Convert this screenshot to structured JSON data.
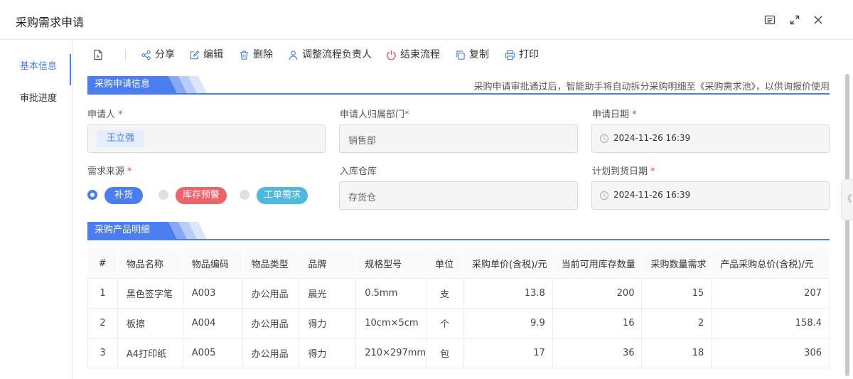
{
  "header": {
    "title": "采购需求申请",
    "icons": [
      "side-panel-icon",
      "expand-icon",
      "close-icon"
    ]
  },
  "sidenav": {
    "items": [
      {
        "label": "基本信息",
        "active": true
      },
      {
        "label": "审批进度",
        "active": false
      }
    ]
  },
  "toolbar": {
    "share": "分享",
    "edit": "编辑",
    "delete": "删除",
    "reassign": "调整流程负责人",
    "end_flow": "结束流程",
    "copy": "复制",
    "print": "打印"
  },
  "section_info": {
    "title": "采购申请信息",
    "note": "采购申请审批通过后，智能助手将自动拆分采购明细至《采购需求池》，以供询报价使用"
  },
  "form": {
    "applicant": {
      "label": "申请人",
      "required": "*",
      "value": "王立强"
    },
    "department": {
      "label": "申请人归属部门",
      "required": "*",
      "value": "销售部"
    },
    "apply_date": {
      "label": "申请日期",
      "required": "*",
      "value": "2024-11-26 16:39"
    },
    "source": {
      "label": "需求来源",
      "required": "*",
      "options": [
        {
          "label": "补货",
          "selected": true,
          "color": "#4a7ef0"
        },
        {
          "label": "库存预警",
          "selected": false,
          "color": "#f0626a"
        },
        {
          "label": "工单需求",
          "selected": false,
          "color": "#4db8e0"
        }
      ]
    },
    "warehouse": {
      "label": "入库仓库",
      "value": "存货仓"
    },
    "arrival_date": {
      "label": "计划到货日期",
      "required": "*",
      "value": "2024-11-26 16:39"
    }
  },
  "section_products": {
    "title": "采购产品明细",
    "columns": [
      "#",
      "物品名称",
      "物品编码",
      "物品类型",
      "品牌",
      "规格型号",
      "单位",
      "采购单价(含税)/元",
      "当前可用库存数量",
      "采购数量需求",
      "产品采购总价(含税)/元"
    ],
    "rows": [
      [
        "1",
        "黑色签字笔",
        "A003",
        "办公用品",
        "晨光",
        "0.5mm",
        "支",
        "13.8",
        "200",
        "15",
        "207"
      ],
      [
        "2",
        "板擦",
        "A004",
        "办公用品",
        "得力",
        "10cm×5cm",
        "个",
        "9.9",
        "16",
        "2",
        "158.4"
      ],
      [
        "3",
        "A4打印纸",
        "A005",
        "办公用品",
        "得力",
        "210×297mm",
        "包",
        "17",
        "36",
        "18",
        "306"
      ]
    ]
  },
  "colors": {
    "accent": "#4a7ef0",
    "danger": "#e5484d"
  },
  "collapse_tab": "《"
}
